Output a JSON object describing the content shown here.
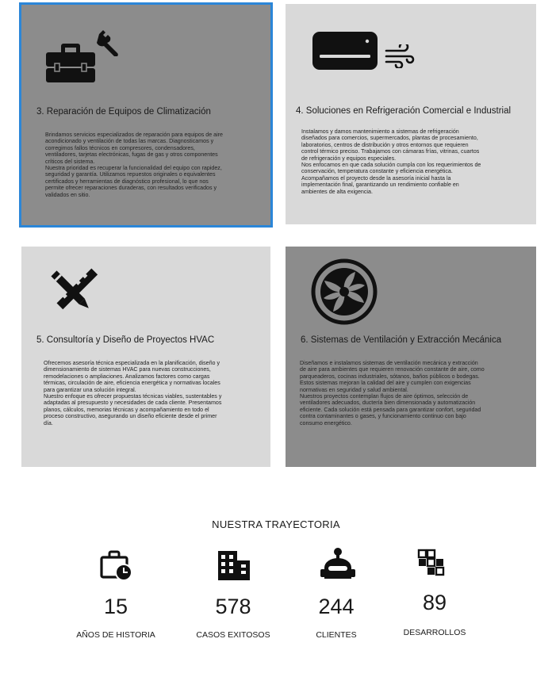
{
  "cards": [
    {
      "title": "3. Reparación de Equipos de Climatización",
      "body": "Brindamos servicios especializados de reparación para equipos de aire\nacondicionado y ventilación de todas las marcas. Diagnosticamos y\ncorregimos fallos técnicos en compresores, condensadores,\nventiladores, tarjetas electrónicas, fugas de gas y otros componentes\ncríticos del sistema.\nNuestra prioridad es recuperar la funcionalidad del equipo con rapidez,\nseguridad y garantía. Utilizamos repuestos originales o equivalentes\ncertificados y herramientas de diagnóstico profesional, lo que nos\npermite ofrecer reparaciones duraderas, con resultados verificados y\nvalidados en sitio."
    },
    {
      "title": "4. Soluciones en Refrigeración Comercial e Industrial",
      "body": "Instalamos y damos mantenimiento a sistemas de refrigeración\ndiseñados para comercios, supermercados, plantas de procesamiento,\nlaboratorios, centros de distribución y otros entornos que requieren\ncontrol térmico preciso. Trabajamos con cámaras frías, vitrinas, cuartos\nde refrigeración y equipos especiales.\nNos enfocamos en que cada solución cumpla con los requerimientos de\nconservación, temperatura constante y eficiencia energética.\nAcompañamos el proyecto desde la asesoría inicial hasta la\nimplementación final, garantizando un rendimiento confiable en\nambientes de alta exigencia."
    },
    {
      "title": "5. Consultoría y Diseño de Proyectos HVAC",
      "body": "Ofrecemos asesoría técnica especializada en la planificación, diseño y\ndimensionamiento de sistemas HVAC para nuevas construcciones,\nremodelaciones o ampliaciones. Analizamos factores como cargas\ntérmicas, circulación de aire, eficiencia energética y normativas locales\npara garantizar una solución integral.\nNuestro enfoque es ofrecer propuestas técnicas viables, sustentables y\nadaptadas al presupuesto y necesidades de cada cliente. Presentamos\nplanos, cálculos, memorias técnicas y acompañamiento en todo el\nproceso constructivo, asegurando un diseño eficiente desde el primer\ndía."
    },
    {
      "title": "6. Sistemas de Ventilación y Extracción Mecánica",
      "body": "Diseñamos e instalamos sistemas de ventilación mecánica y extracción\nde aire para ambientes que requieren renovación constante de aire, como\nparqueaderos, cocinas industriales, sótanos, baños públicos o bodegas.\nEstos sistemas mejoran la calidad del aire y cumplen con exigencias\nnormativas en seguridad y salud ambiental.\nNuestros proyectos contemplan flujos de aire óptimos, selección de\nventiladores adecuados, ductería bien dimensionada y automatización\neficiente. Cada solución está pensada para garantizar confort, seguridad\ncontra contaminantes o gases, y funcionamiento continuo con bajo\nconsumo energético."
    }
  ],
  "icons": {
    "card3": [
      "toolbox-icon",
      "wrench-icon"
    ],
    "card4": [
      "air-conditioner-icon",
      "wind-icon"
    ],
    "card5": [
      "design-tools-icon"
    ],
    "card6": [
      "fan-icon"
    ]
  },
  "trajectory": {
    "title": "NUESTRA TRAYECTORIA",
    "stats": [
      {
        "value": "15",
        "label": "AÑOS DE HISTORIA",
        "icon": "briefcase-clock-icon"
      },
      {
        "value": "578",
        "label": "CASOS EXITOSOS",
        "icon": "buildings-icon"
      },
      {
        "value": "244",
        "label": "CLIENTES",
        "icon": "robot-icon"
      },
      {
        "value": "89",
        "label": "DESARROLLOS",
        "icon": "blocks-icon"
      }
    ]
  },
  "colors": {
    "card_light": "#d9d9d9",
    "card_dark": "#8c8c8c",
    "selection_border": "#2b86d8"
  }
}
